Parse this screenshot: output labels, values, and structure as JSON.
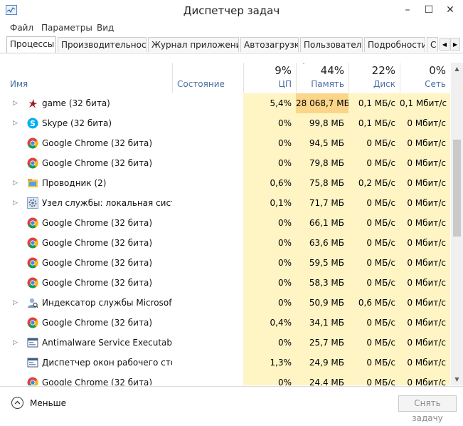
{
  "window": {
    "title": "Диспетчер задач",
    "minimize": "–",
    "maximize": "☐",
    "close": "✕"
  },
  "menu": [
    "Файл",
    "Параметры",
    "Вид"
  ],
  "tabs": [
    "Процессы",
    "Производительность",
    "Журнал приложений",
    "Автозагрузка",
    "Пользователи",
    "Подробности",
    "С"
  ],
  "tab_scroll": {
    "left": "◀",
    "right": "▶"
  },
  "columns": {
    "name": "Имя",
    "status": "Состояние",
    "cpu": {
      "pct": "9%",
      "label": "ЦП"
    },
    "memory": {
      "pct": "44%",
      "label": "Память",
      "sort": "ˇ"
    },
    "disk": {
      "pct": "22%",
      "label": "Диск"
    },
    "network": {
      "pct": "0%",
      "label": "Сеть"
    }
  },
  "processes": [
    {
      "name": "game (32 бита)",
      "icon": "game-icon",
      "expandable": true,
      "cpu": "5,4%",
      "memory": "28 068,7 МБ",
      "disk": "0,1 МБ/с",
      "network": "0,1 Мбит/с"
    },
    {
      "name": "Skype (32 бита)",
      "icon": "skype-icon",
      "expandable": true,
      "cpu": "0%",
      "memory": "99,8 МБ",
      "disk": "0,1 МБ/с",
      "network": "0 Мбит/с"
    },
    {
      "name": "Google Chrome (32 бита)",
      "icon": "chrome-icon",
      "expandable": false,
      "cpu": "0%",
      "memory": "94,5 МБ",
      "disk": "0 МБ/с",
      "network": "0 Мбит/с"
    },
    {
      "name": "Google Chrome (32 бита)",
      "icon": "chrome-icon",
      "expandable": false,
      "cpu": "0%",
      "memory": "79,8 МБ",
      "disk": "0 МБ/с",
      "network": "0 Мбит/с"
    },
    {
      "name": "Проводник (2)",
      "icon": "explorer-folder-icon",
      "expandable": true,
      "cpu": "0,6%",
      "memory": "75,8 МБ",
      "disk": "0,2 МБ/с",
      "network": "0 Мбит/с"
    },
    {
      "name": "Узел службы: локальная систе...",
      "icon": "service-gear-icon",
      "expandable": true,
      "cpu": "0,1%",
      "memory": "71,7 МБ",
      "disk": "0 МБ/с",
      "network": "0 Мбит/с"
    },
    {
      "name": "Google Chrome (32 бита)",
      "icon": "chrome-icon",
      "expandable": false,
      "cpu": "0%",
      "memory": "66,1 МБ",
      "disk": "0 МБ/с",
      "network": "0 Мбит/с"
    },
    {
      "name": "Google Chrome (32 бита)",
      "icon": "chrome-icon",
      "expandable": false,
      "cpu": "0%",
      "memory": "63,6 МБ",
      "disk": "0 МБ/с",
      "network": "0 Мбит/с"
    },
    {
      "name": "Google Chrome (32 бита)",
      "icon": "chrome-icon",
      "expandable": false,
      "cpu": "0%",
      "memory": "59,5 МБ",
      "disk": "0 МБ/с",
      "network": "0 Мбит/с"
    },
    {
      "name": "Google Chrome (32 бита)",
      "icon": "chrome-icon",
      "expandable": false,
      "cpu": "0%",
      "memory": "58,3 МБ",
      "disk": "0 МБ/с",
      "network": "0 Мбит/с"
    },
    {
      "name": "Индексатор службы Microsoft ...",
      "icon": "indexer-user-icon",
      "expandable": true,
      "cpu": "0%",
      "memory": "50,9 МБ",
      "disk": "0,6 МБ/с",
      "network": "0 Мбит/с"
    },
    {
      "name": "Google Chrome (32 бита)",
      "icon": "chrome-icon",
      "expandable": false,
      "cpu": "0,4%",
      "memory": "34,1 МБ",
      "disk": "0 МБ/с",
      "network": "0 Мбит/с"
    },
    {
      "name": "Antimalware Service Executable",
      "icon": "app-window-icon",
      "expandable": true,
      "cpu": "0%",
      "memory": "25,7 МБ",
      "disk": "0 МБ/с",
      "network": "0 Мбит/с"
    },
    {
      "name": "Диспетчер окон рабочего стола",
      "icon": "app-window-icon",
      "expandable": false,
      "cpu": "1,3%",
      "memory": "24,9 МБ",
      "disk": "0 МБ/с",
      "network": "0 Мбит/с"
    },
    {
      "name": "Google Chrome (32 бита)",
      "icon": "chrome-icon",
      "expandable": false,
      "cpu": "0%",
      "memory": "24,4 МБ",
      "disk": "0 МБ/с",
      "network": "0 Мбит/с"
    }
  ],
  "footer": {
    "less_label": "Меньше",
    "end_task": "Снять задачу"
  },
  "colors": {
    "cell_bg": "#fff4c4",
    "memory_hot": "#fbd68a",
    "header_label": "#4a6fa5"
  }
}
